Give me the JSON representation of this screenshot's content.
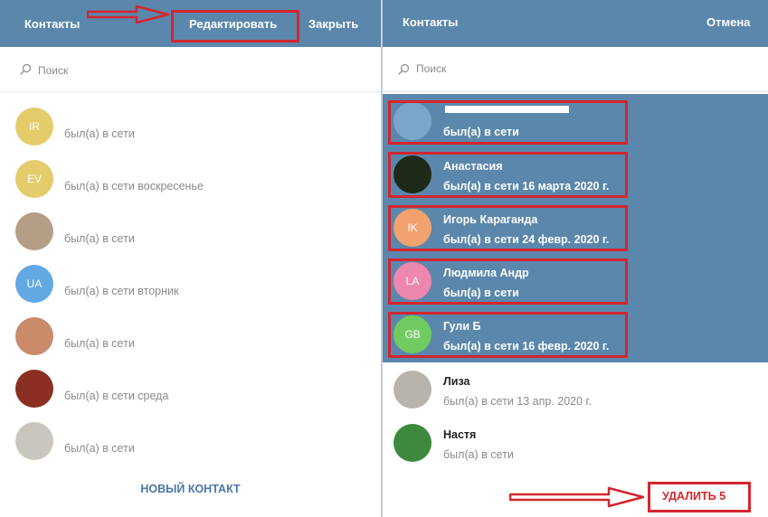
{
  "left": {
    "header": {
      "title": "Контакты",
      "edit_label": "Редактировать",
      "close_label": "Закрыть"
    },
    "search": {
      "placeholder": "Поиск"
    },
    "contacts": [
      {
        "initials": "IR",
        "status": "был(а) в сети",
        "avatar_color": "#e4cc6a"
      },
      {
        "initials": "EV",
        "status": "был(а) в сети воскресенье",
        "avatar_color": "#e4cc6a"
      },
      {
        "initials": "",
        "status": "был(а) в сети",
        "avatar_color": "#b59e86"
      },
      {
        "initials": "UA",
        "status": "был(а) в сети вторник",
        "avatar_color": "#62a9e3"
      },
      {
        "initials": "",
        "status": "был(а) в сети",
        "avatar_color": "#c98b6a"
      },
      {
        "initials": "",
        "status": "был(а) в сети среда",
        "avatar_color": "#8a2f22"
      },
      {
        "initials": "",
        "status": "был(а) в сети",
        "avatar_color": "#c9c7bd"
      }
    ],
    "new_contact_label": "НОВЫЙ КОНТАКТ"
  },
  "right": {
    "header": {
      "title": "Контакты",
      "cancel_label": "Отмена"
    },
    "search": {
      "placeholder": "Поиск"
    },
    "contacts": [
      {
        "name": "",
        "initials": "",
        "status": "был(а) в сети",
        "avatar_color": "#7aa6c9",
        "selected": true
      },
      {
        "name": "Анастасия",
        "initials": "",
        "status": "был(а) в сети 16 марта 2020 г.",
        "avatar_color": "#1d2a18",
        "selected": true
      },
      {
        "name": "Игорь Караганда",
        "initials": "IK",
        "status": "был(а) в сети 24 февр. 2020 г.",
        "avatar_color": "#f2a26e",
        "selected": true
      },
      {
        "name": "Людмила Андр",
        "initials": "LA",
        "status": "был(а) в сети",
        "avatar_color": "#ee87ad",
        "selected": true
      },
      {
        "name": "Гули Б",
        "initials": "GB",
        "status": "был(а) в сети 16 февр. 2020 г.",
        "avatar_color": "#71cb60",
        "selected": true
      },
      {
        "name": "Лиза",
        "initials": "",
        "status": "был(а) в сети 13 апр. 2020 г.",
        "avatar_color": "#b9b3ad",
        "selected": false
      },
      {
        "name": "Настя",
        "initials": "",
        "status": "был(а) в сети",
        "avatar_color": "#3d8a3f",
        "selected": false
      }
    ],
    "delete_label": "УДАЛИТЬ 5"
  },
  "colors": {
    "header": "#5b87ac",
    "selected_row": "#5b87ac",
    "annotation_red": "#d3262f",
    "link_blue": "#4a76a8"
  }
}
